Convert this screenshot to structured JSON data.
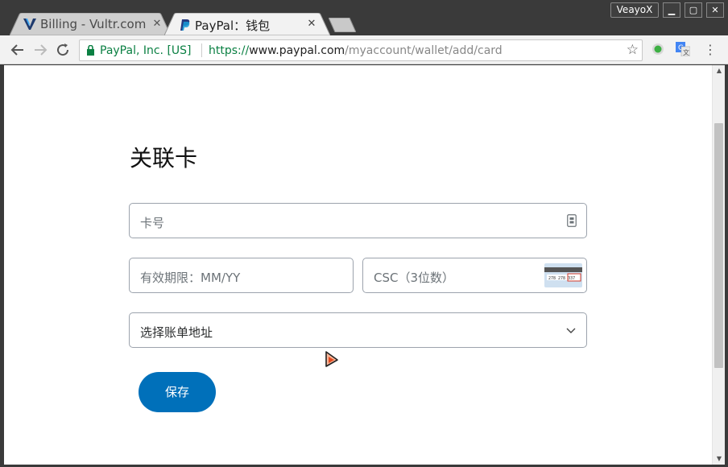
{
  "browser": {
    "profile_name": "VeayoX",
    "tabs": [
      {
        "title": "Billing - Vultr.com",
        "favicon": "vultr-v-icon",
        "active": false
      },
      {
        "title": "PayPal：钱包",
        "favicon": "paypal-p-icon",
        "active": true
      }
    ],
    "address_bar": {
      "origin_label": "PayPal, Inc. [US]",
      "scheme": "https://",
      "host": "www.paypal.com",
      "path": "/myaccount/wallet/add/card"
    },
    "icons": [
      "back-arrow-icon",
      "forward-arrow-icon",
      "reload-icon",
      "lock-icon",
      "star-icon",
      "extension-green-dot-icon",
      "google-translate-icon",
      "more-menu-icon"
    ]
  },
  "page": {
    "title": "关联卡",
    "card_number_placeholder": "卡号",
    "expiry_placeholder": "有效期限：MM/YY",
    "csc_placeholder": "CSC（3位数）",
    "billing_address_select": "选择账单地址",
    "save_label": "保存",
    "csc_card_digits": "278 278 337",
    "accent_color": "#0070ba"
  }
}
